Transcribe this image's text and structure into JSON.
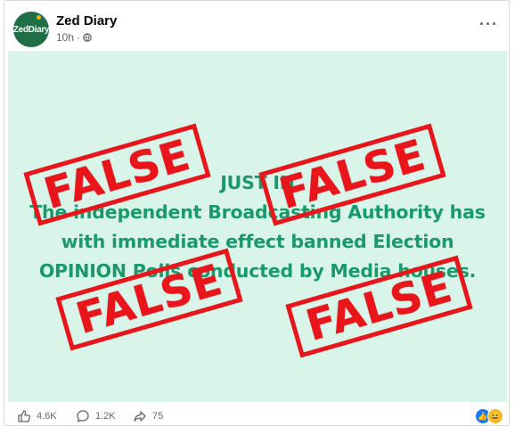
{
  "post": {
    "page_name": "Zed Diary",
    "avatar_text": "ZedDiary",
    "time": "10h",
    "separator": "·",
    "more": "···"
  },
  "image": {
    "headline_lines": [
      "JUST IN",
      "The independent Broadcasting Authority has",
      "with immediate effect banned Election",
      "OPINION Polls conducted by Media houses."
    ],
    "stamp_text": "FALSE",
    "colors": {
      "background": "#d9f5ea",
      "text": "#1a9a6b",
      "stamp": "#e8151b"
    }
  },
  "footer": {
    "likes": "4.6K",
    "comments": "1.2K",
    "shares": "75",
    "icons": [
      "thumbs-up-icon",
      "comment-icon",
      "share-icon"
    ],
    "reactions": [
      "like-reaction-icon",
      "haha-reaction-icon"
    ]
  }
}
